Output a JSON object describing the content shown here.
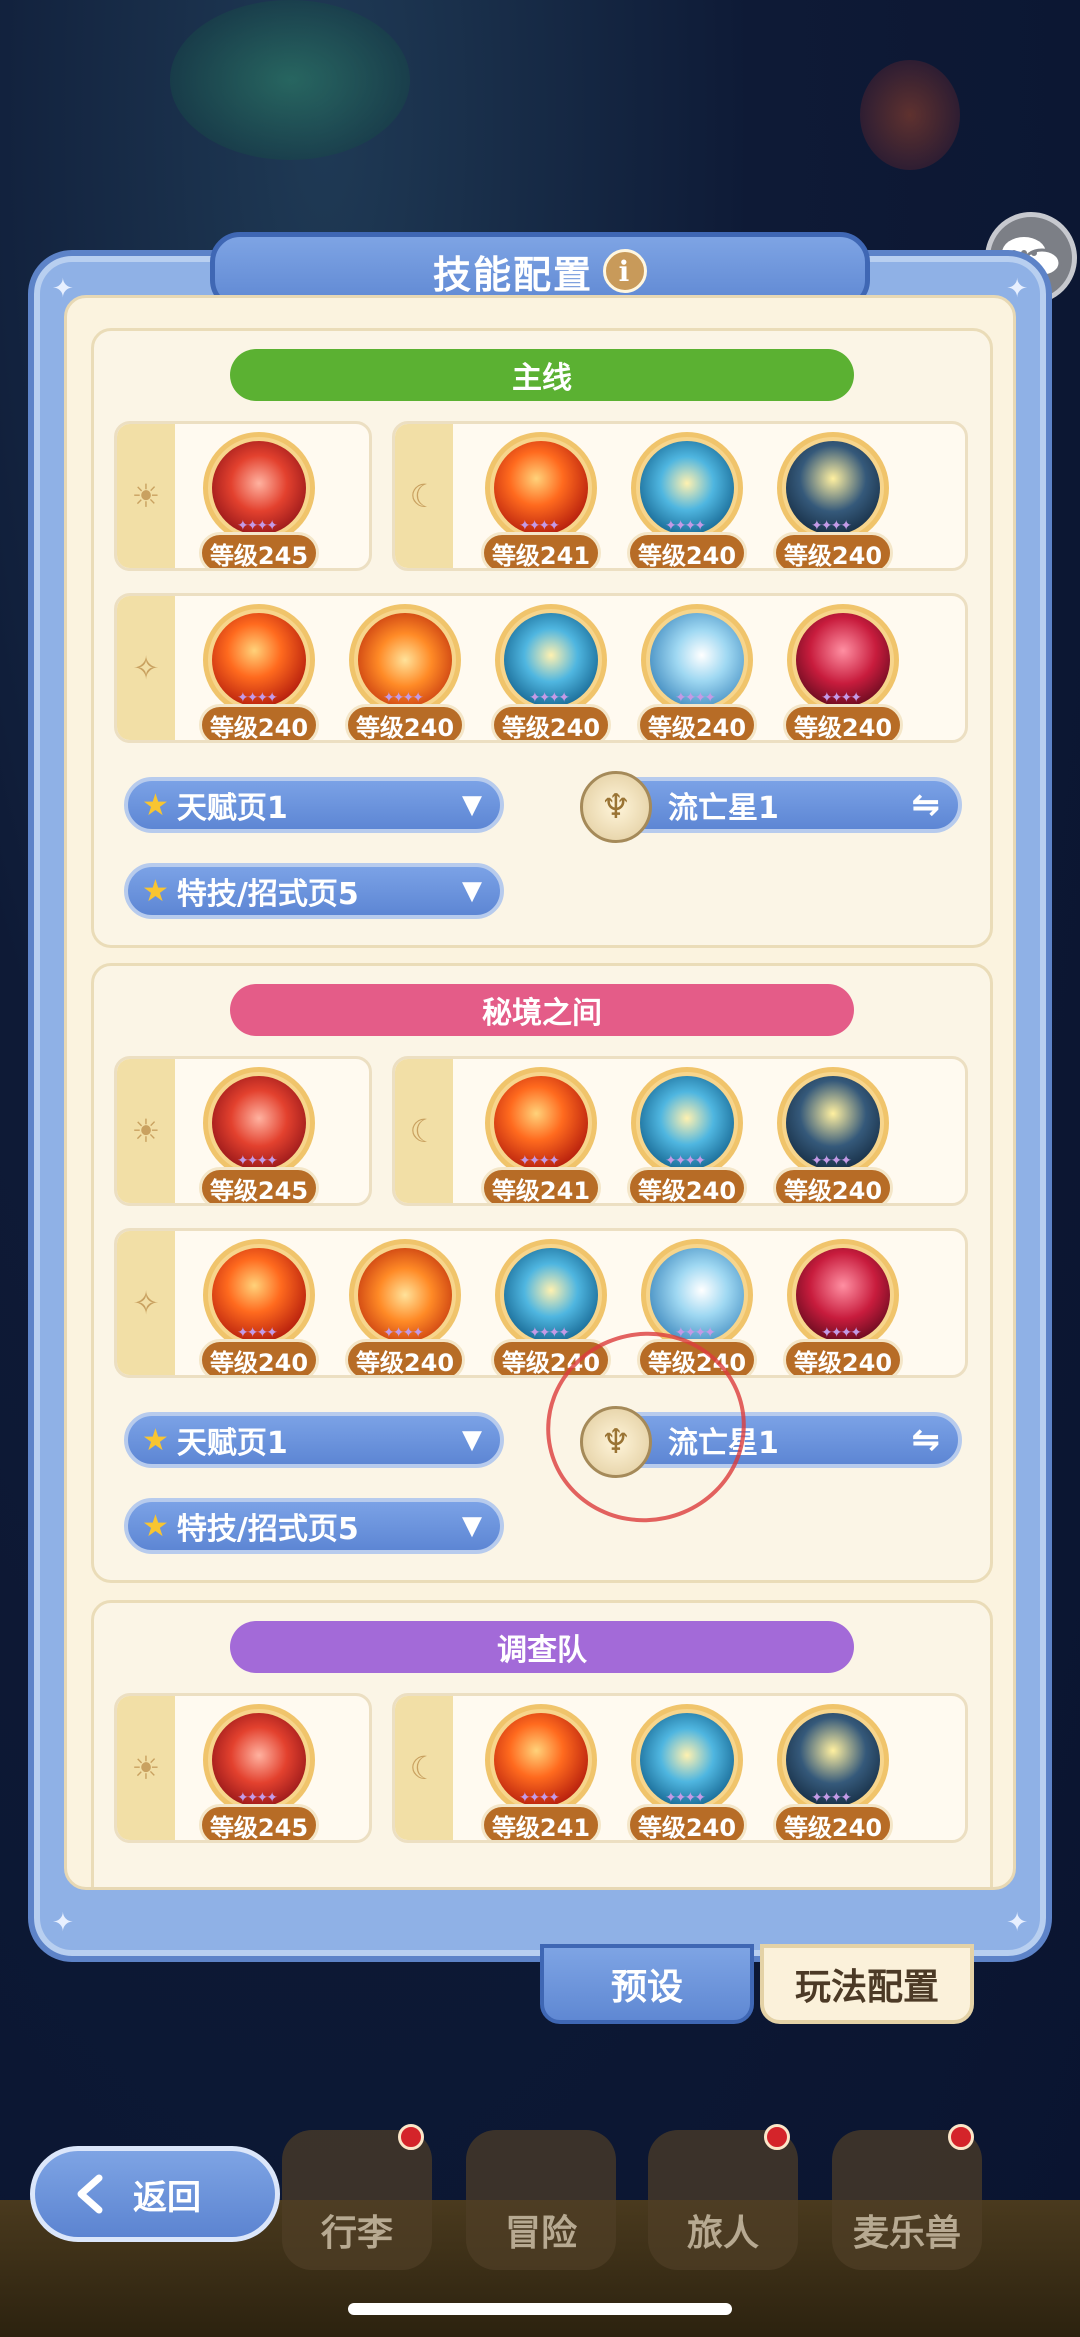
{
  "title": "技能配置",
  "info_glyph": "i",
  "level_prefix": "等级",
  "sections": [
    {
      "name": "主线",
      "color": "#5bb132",
      "row1_left": [
        {
          "art": "red",
          "level": "等级245"
        }
      ],
      "row1_right": [
        {
          "art": "fire",
          "level": "等级241"
        },
        {
          "art": "blue",
          "level": "等级240"
        },
        {
          "art": "dark",
          "level": "等级240"
        }
      ],
      "row2": [
        {
          "art": "fire",
          "level": "等级240"
        },
        {
          "art": "orb",
          "level": "等级240"
        },
        {
          "art": "blue",
          "level": "等级240"
        },
        {
          "art": "sky",
          "level": "等级240"
        },
        {
          "art": "crim",
          "level": "等级240"
        }
      ],
      "talent": "天赋页1",
      "star_page": "流亡星1",
      "technique": "特技/招式页5"
    },
    {
      "name": "秘境之间",
      "color": "#e45c88",
      "row1_left": [
        {
          "art": "red",
          "level": "等级245"
        }
      ],
      "row1_right": [
        {
          "art": "fire",
          "level": "等级241"
        },
        {
          "art": "blue",
          "level": "等级240"
        },
        {
          "art": "dark",
          "level": "等级240"
        }
      ],
      "row2": [
        {
          "art": "fire",
          "level": "等级240"
        },
        {
          "art": "orb",
          "level": "等级240"
        },
        {
          "art": "blue",
          "level": "等级240"
        },
        {
          "art": "sky",
          "level": "等级240"
        },
        {
          "art": "crim",
          "level": "等级240"
        }
      ],
      "talent": "天赋页1",
      "star_page": "流亡星1",
      "technique": "特技/招式页5"
    },
    {
      "name": "调查队",
      "color": "#a36ad8",
      "row1_left": [
        {
          "art": "red",
          "level": "等级245"
        }
      ],
      "row1_right": [
        {
          "art": "fire",
          "level": "等级241"
        },
        {
          "art": "blue",
          "level": "等级240"
        },
        {
          "art": "dark",
          "level": "等级240"
        }
      ]
    }
  ],
  "tabs": {
    "preset": "预设",
    "play_config": "玩法配置"
  },
  "back_label": "返回",
  "nav": [
    "行李",
    "冒险",
    "旅人",
    "麦乐兽"
  ],
  "icons": {
    "sun": "sun-icon",
    "moon": "moon-icon",
    "spark": "spark-icon",
    "star": "star-icon",
    "swap": "swap-icon",
    "caret": "caret-down-icon",
    "chat": "chat-icon",
    "back": "back-arrow-icon"
  }
}
